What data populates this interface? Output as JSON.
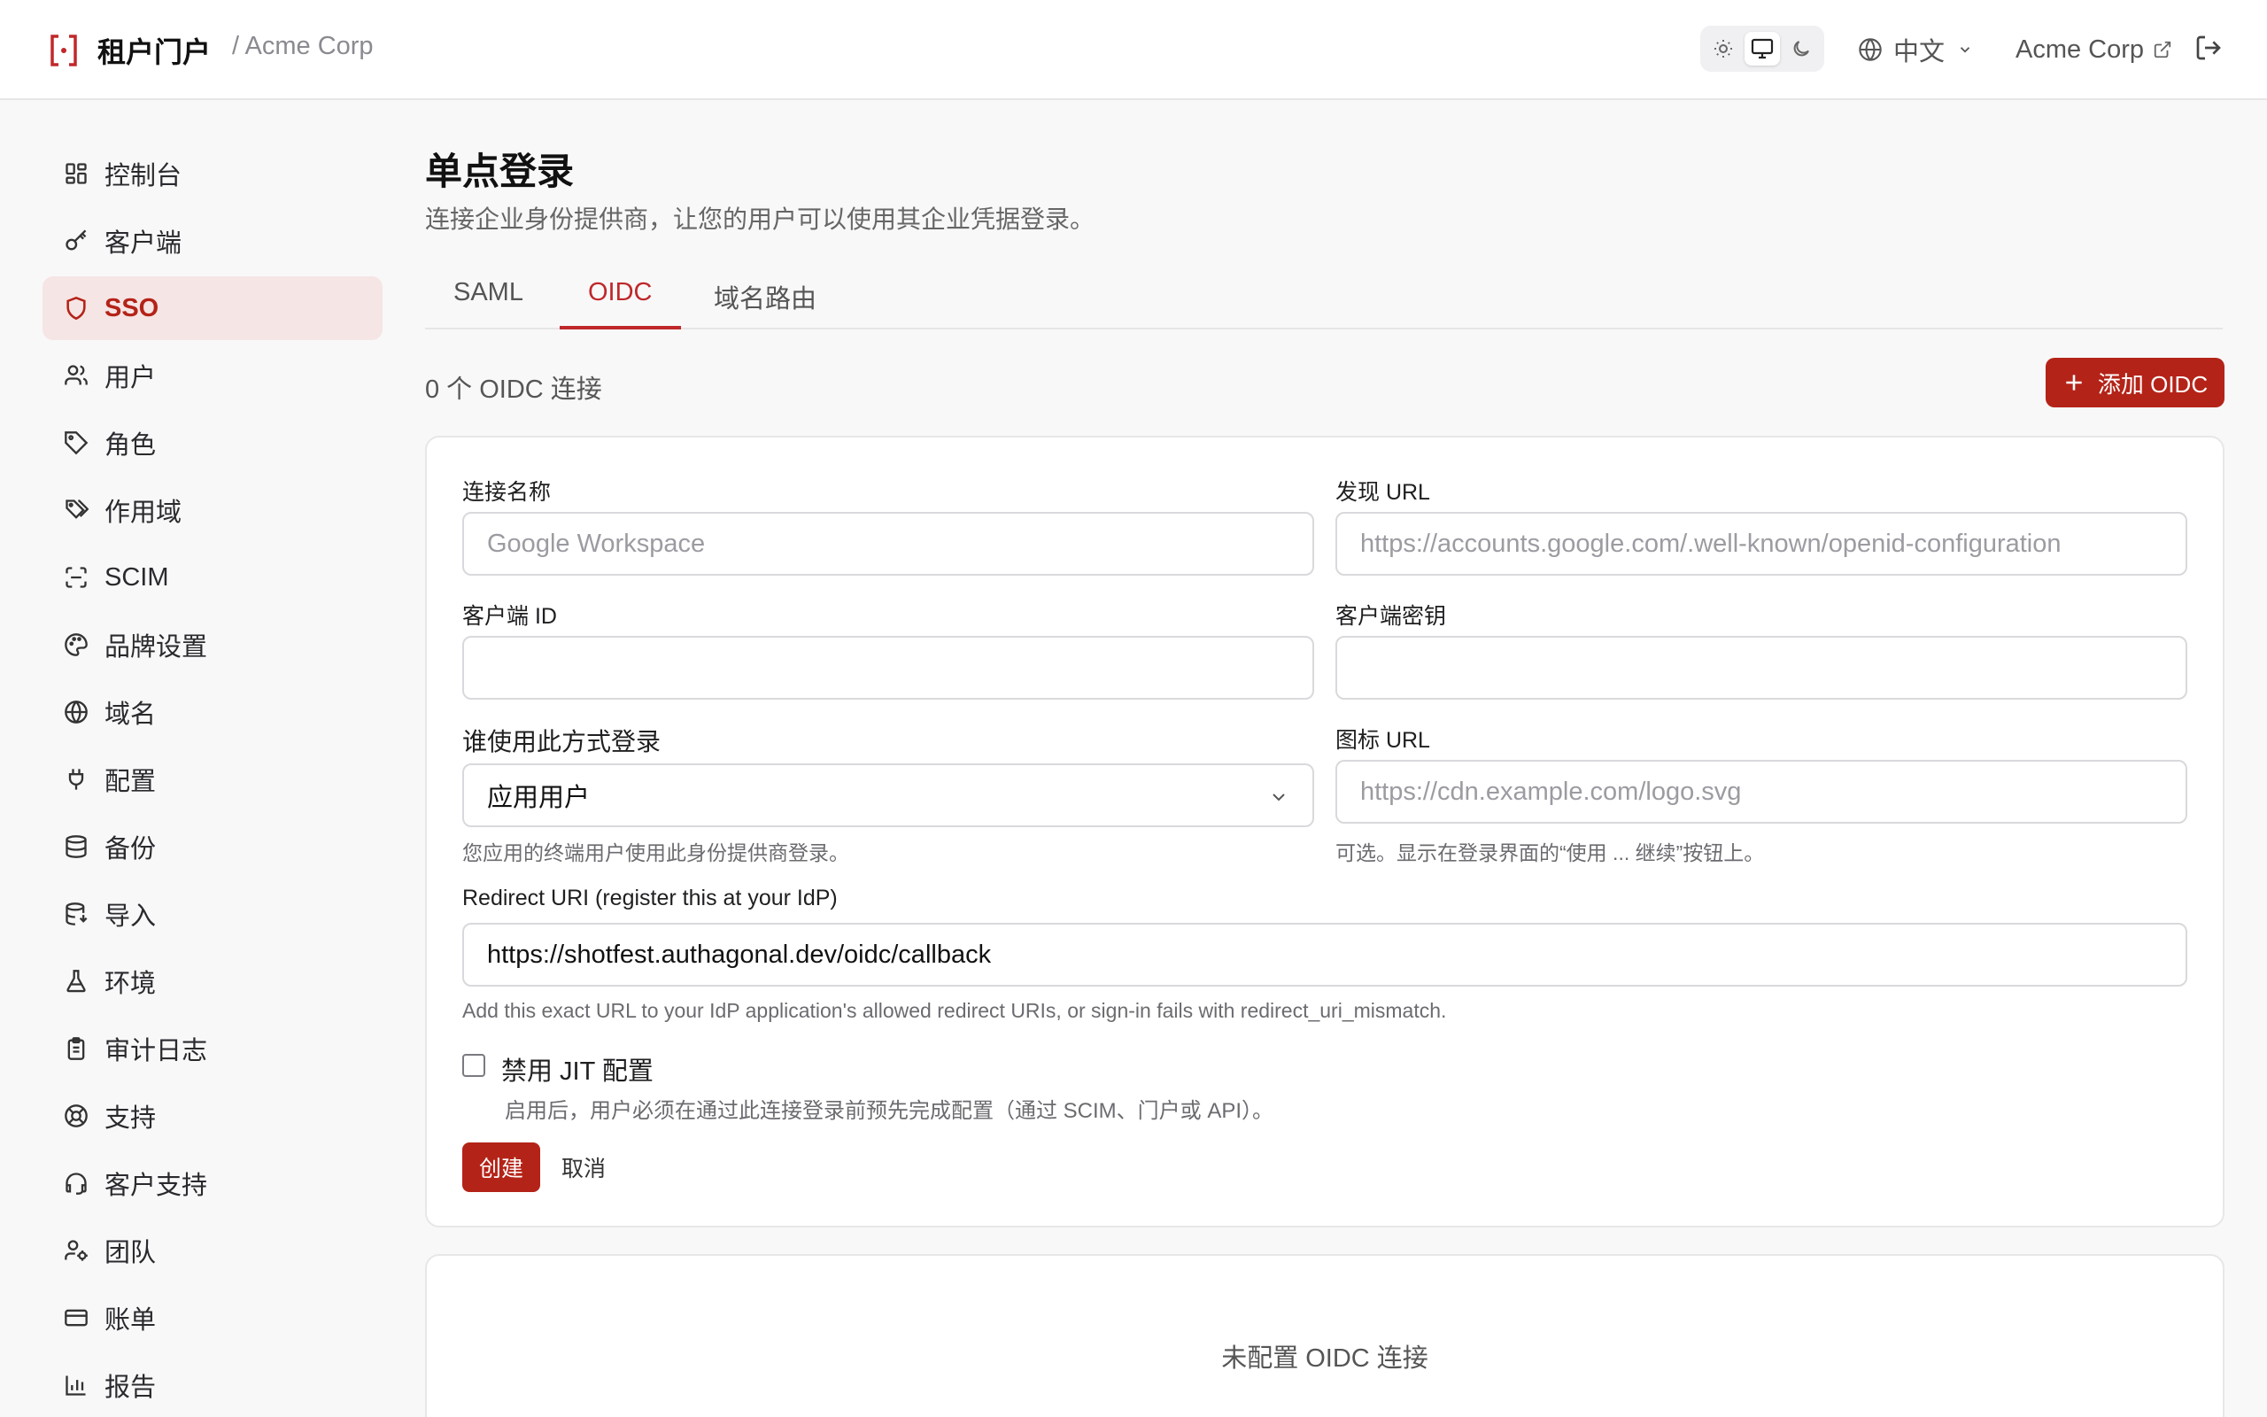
{
  "header": {
    "brand": "租户门户",
    "breadcrumb": "/ Acme Corp",
    "language": "中文",
    "org_name": "Acme Corp"
  },
  "sidebar": {
    "items": [
      {
        "label": "控制台",
        "icon": "dashboard-icon"
      },
      {
        "label": "客户端",
        "icon": "key-icon"
      },
      {
        "label": "SSO",
        "icon": "shield-icon",
        "active": true
      },
      {
        "label": "用户",
        "icon": "users-icon"
      },
      {
        "label": "角色",
        "icon": "tag-icon"
      },
      {
        "label": "作用域",
        "icon": "tags-icon"
      },
      {
        "label": "SCIM",
        "icon": "scan-icon"
      },
      {
        "label": "品牌设置",
        "icon": "palette-icon"
      },
      {
        "label": "域名",
        "icon": "globe-icon"
      },
      {
        "label": "配置",
        "icon": "plug-icon"
      },
      {
        "label": "备份",
        "icon": "database-icon"
      },
      {
        "label": "导入",
        "icon": "database-import-icon"
      },
      {
        "label": "环境",
        "icon": "flask-icon"
      },
      {
        "label": "审计日志",
        "icon": "clipboard-icon"
      },
      {
        "label": "支持",
        "icon": "lifebuoy-icon"
      },
      {
        "label": "客户支持",
        "icon": "headset-icon"
      },
      {
        "label": "团队",
        "icon": "user-cog-icon"
      },
      {
        "label": "账单",
        "icon": "credit-card-icon"
      },
      {
        "label": "报告",
        "icon": "bar-chart-icon"
      }
    ]
  },
  "main": {
    "title": "单点登录",
    "subtitle": "连接企业身份提供商，让您的用户可以使用其企业凭据登录。",
    "tabs": [
      {
        "label": "SAML"
      },
      {
        "label": "OIDC",
        "active": true
      },
      {
        "label": "域名路由"
      }
    ],
    "count_text": "0 个 OIDC 连接",
    "add_button": "添加 OIDC"
  },
  "form": {
    "connection_name": {
      "label": "连接名称",
      "placeholder": "Google Workspace",
      "value": ""
    },
    "discovery_url": {
      "label": "发现 URL",
      "placeholder": "https://accounts.google.com/.well-known/openid-configuration",
      "value": ""
    },
    "client_id": {
      "label": "客户端 ID",
      "value": ""
    },
    "client_secret": {
      "label": "客户端密钥",
      "value": ""
    },
    "who_signs_in": {
      "label": "谁使用此方式登录",
      "value": "应用用户",
      "help": "您应用的终端用户使用此身份提供商登录。"
    },
    "icon_url": {
      "label": "图标 URL",
      "placeholder": "https://cdn.example.com/logo.svg",
      "help": "可选。显示在登录界面的“使用 ... 继续”按钮上。"
    },
    "redirect_uri": {
      "label": "Redirect URI (register this at your IdP)",
      "value": "https://shotfest.authagonal.dev/oidc/callback",
      "help": "Add this exact URL to your IdP application's allowed redirect URIs, or sign-in fails with redirect_uri_mismatch."
    },
    "disable_jit": {
      "label": "禁用 JIT 配置",
      "checked": false,
      "help": "启用后，用户必须在通过此连接登录前预先完成配置（通过 SCIM、门户或 API）。"
    },
    "create_button": "创建",
    "cancel_button": "取消"
  },
  "empty_state": "未配置 OIDC 连接",
  "colors": {
    "accent": "#b42318",
    "active_bg": "#f6e5e5"
  }
}
